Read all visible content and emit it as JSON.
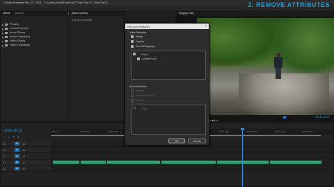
{
  "window": {
    "title": "Adobe Premiere Pro CC 2018 - C:\\Users\\Jacob\\Desktop\\7 Trick Part 2\\7 Trick Part 2"
  },
  "menu": [
    "File",
    "Edit",
    "Clip",
    "Sequence",
    "Markers",
    "Graphics",
    "Window",
    "Help"
  ],
  "overlay_title": "2. REMOVE ATTRIBUTES",
  "effects_panel": {
    "tabs": [
      "Effects",
      "Markers"
    ],
    "items": [
      "Presets",
      "Lumetri Presets",
      "Audio Effects",
      "Audio Transitions",
      "Video Effects",
      "Video Transitions"
    ]
  },
  "effect_controls": {
    "tab": "Effect Controls",
    "message": "(no clips selected)"
  },
  "program_monitor": {
    "tab": "Program: Seq",
    "timecode": "00:00:14:23",
    "transport": "⏮ ◀ ▶ ▶▶ ⏭"
  },
  "dialog": {
    "title": "Remove Attributes",
    "close": "×",
    "video_section": "Video Attributes",
    "motion": "Motion",
    "opacity": "Opacity",
    "time_remapping": "Time Remapping",
    "effects_header": "Effects",
    "lumetri": "Lumetri Color",
    "audio_section": "Audio Attributes",
    "volume": "Volume",
    "channel_volume": "Channel Volume",
    "panner": "Panner",
    "audio_effects_header": "Effects",
    "ok": "OK",
    "cancel": "Cancel"
  },
  "timeline": {
    "timecode": "00:00:10:12",
    "ruler": [
      "00:00",
      "00:00:02:00",
      "00:00:04:00",
      "00:00:06:00",
      "00:00:08:00",
      "00:00:10:00",
      "00:00:12:00",
      "00:00:14:00",
      "00:00:16:00",
      "00:00:18:00"
    ],
    "tracks": [
      {
        "name": "V3",
        "target": "V3"
      },
      {
        "name": "V2",
        "target": "V2"
      },
      {
        "name": "V1",
        "target": "V1"
      },
      {
        "name": "A1",
        "target": "A1"
      },
      {
        "name": "A2",
        "target": "A2"
      }
    ],
    "video_clips": [
      "DJI_0002001",
      "DJI_0007001",
      "DJI_0008001",
      "DJI_0014001",
      "DJI_0016001",
      "DJI_0022001"
    ],
    "audio_clips": [
      "",
      "",
      "",
      "",
      "",
      ""
    ]
  }
}
